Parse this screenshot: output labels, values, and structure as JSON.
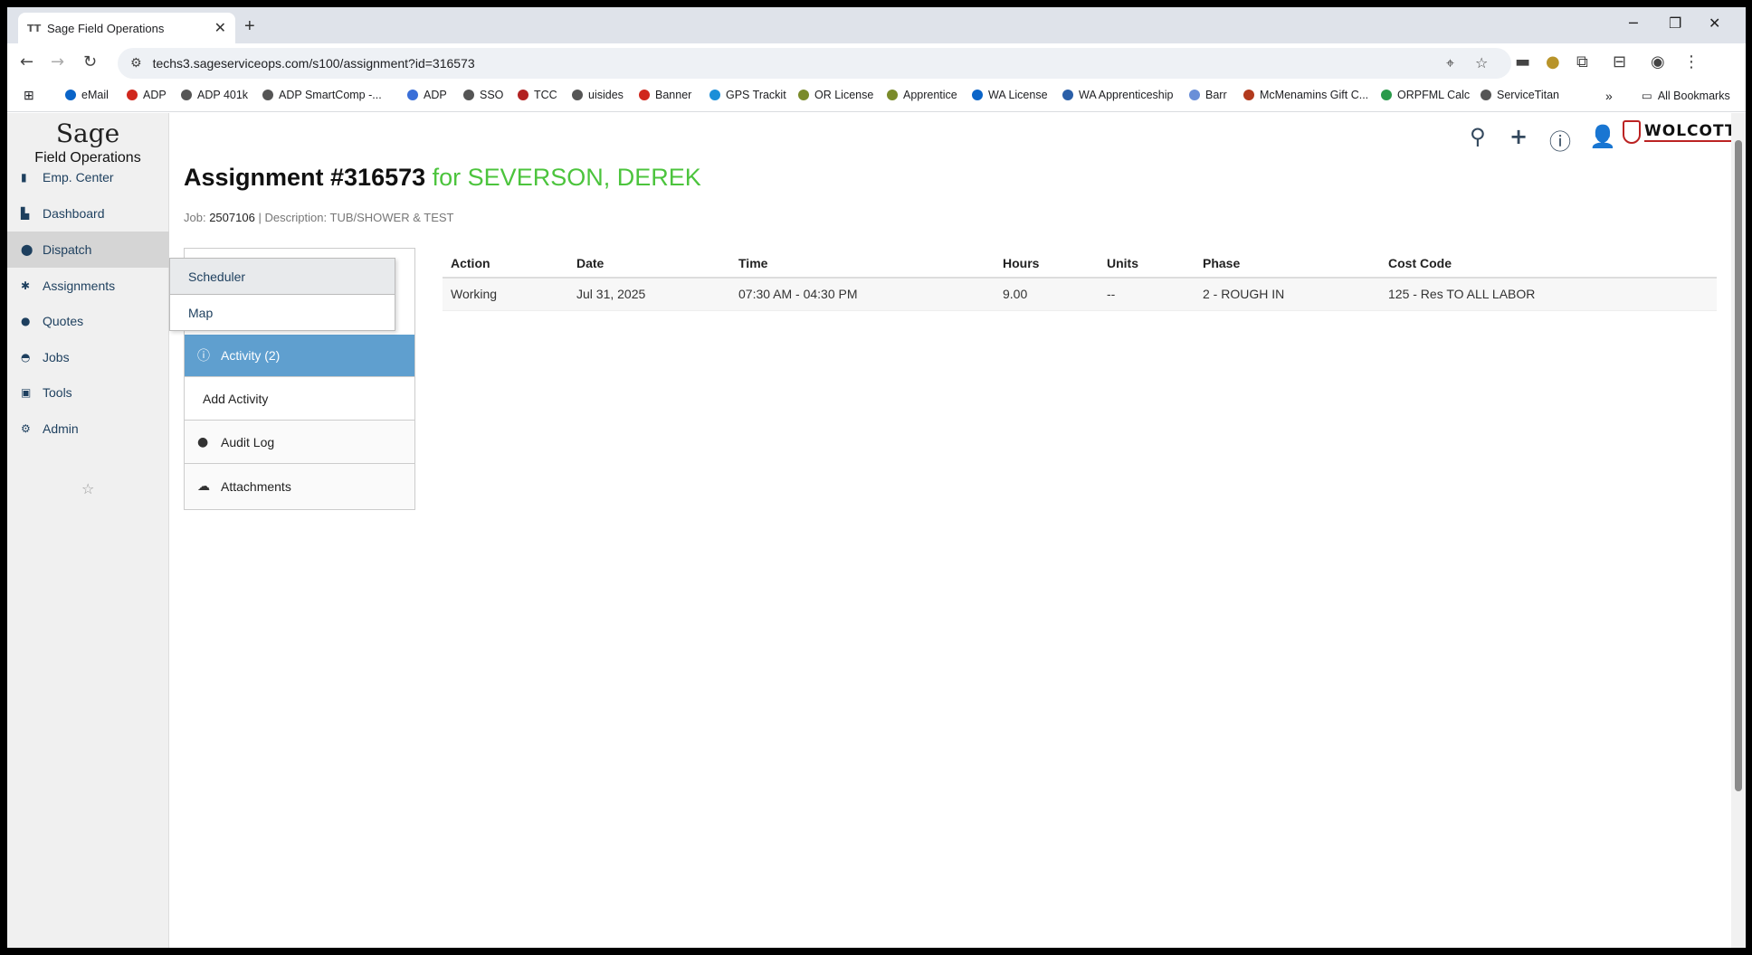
{
  "browser": {
    "tab_favicon": "TT",
    "tab_title": "Sage Field Operations",
    "url": "techs3.sageserviceops.com/s100/assignment?id=316573",
    "bookmarks": [
      {
        "label": "eMail",
        "color": "#0a64c8"
      },
      {
        "label": "ADP",
        "color": "#d0271d"
      },
      {
        "label": "ADP 401k",
        "color": "#555555"
      },
      {
        "label": "ADP SmartComp -...",
        "color": "#555555"
      },
      {
        "label": "ADP",
        "color": "#3a6fd8"
      },
      {
        "label": "SSO",
        "color": "#555555"
      },
      {
        "label": "TCC",
        "color": "#b22222"
      },
      {
        "label": "uisides",
        "color": "#555555"
      },
      {
        "label": "Banner",
        "color": "#d0271d"
      },
      {
        "label": "GPS Trackit",
        "color": "#1a8fd8"
      },
      {
        "label": "OR License",
        "color": "#7a8b2a"
      },
      {
        "label": "Apprentice",
        "color": "#7a8b2a"
      },
      {
        "label": "WA License",
        "color": "#0a64c8"
      },
      {
        "label": "WA Apprenticeship",
        "color": "#2a5fa8"
      },
      {
        "label": "Barr",
        "color": "#6a8fd8"
      },
      {
        "label": "McMenamins Gift C...",
        "color": "#b23a1d"
      },
      {
        "label": "ORPFML Calc",
        "color": "#2a9a4a"
      },
      {
        "label": "ServiceTitan",
        "color": "#555555"
      }
    ],
    "all_bookmarks": "All Bookmarks"
  },
  "sidebar": {
    "logo_main": "Sage",
    "logo_sub": "Field Operations",
    "items": [
      {
        "label": "Emp. Center",
        "icon": "building-icon"
      },
      {
        "label": "Dashboard",
        "icon": "chart-icon"
      },
      {
        "label": "Dispatch",
        "icon": "map-pin-icon"
      },
      {
        "label": "Assignments",
        "icon": "thumbtack-icon"
      },
      {
        "label": "Quotes",
        "icon": "comment-icon"
      },
      {
        "label": "Jobs",
        "icon": "hardhat-icon"
      },
      {
        "label": "Tools",
        "icon": "toolbox-icon"
      },
      {
        "label": "Admin",
        "icon": "users-cog-icon"
      }
    ]
  },
  "dispatch_menu": {
    "items": [
      "Scheduler",
      "Map"
    ]
  },
  "header": {
    "brand": "WOLCOTT",
    "brand_color": "#b22222"
  },
  "page": {
    "title": "Assignment #316573",
    "for_text": "for SEVERSON, DEREK",
    "job_label": "Job:",
    "job_number": "2507106",
    "separator": "|",
    "description_label": "Description:",
    "description": "TUB/SHOWER & TEST"
  },
  "panel": {
    "activity": "Activity (2)",
    "add_activity": "Add Activity",
    "audit_log": "Audit Log",
    "attachments": "Attachments"
  },
  "table": {
    "headers": [
      "Action",
      "Date",
      "Time",
      "Hours",
      "Units",
      "Phase",
      "Cost Code"
    ],
    "rows": [
      [
        "Working",
        "Jul 31, 2025",
        "07:30 AM - 04:30 PM",
        "9.00",
        "--",
        "2 - ROUGH IN",
        "125 - Res TO ALL LABOR"
      ]
    ]
  },
  "colors": {
    "accent_green": "#4cc43d",
    "active_blue": "#5f9fcf",
    "nav_text": "#1d3f5e"
  }
}
